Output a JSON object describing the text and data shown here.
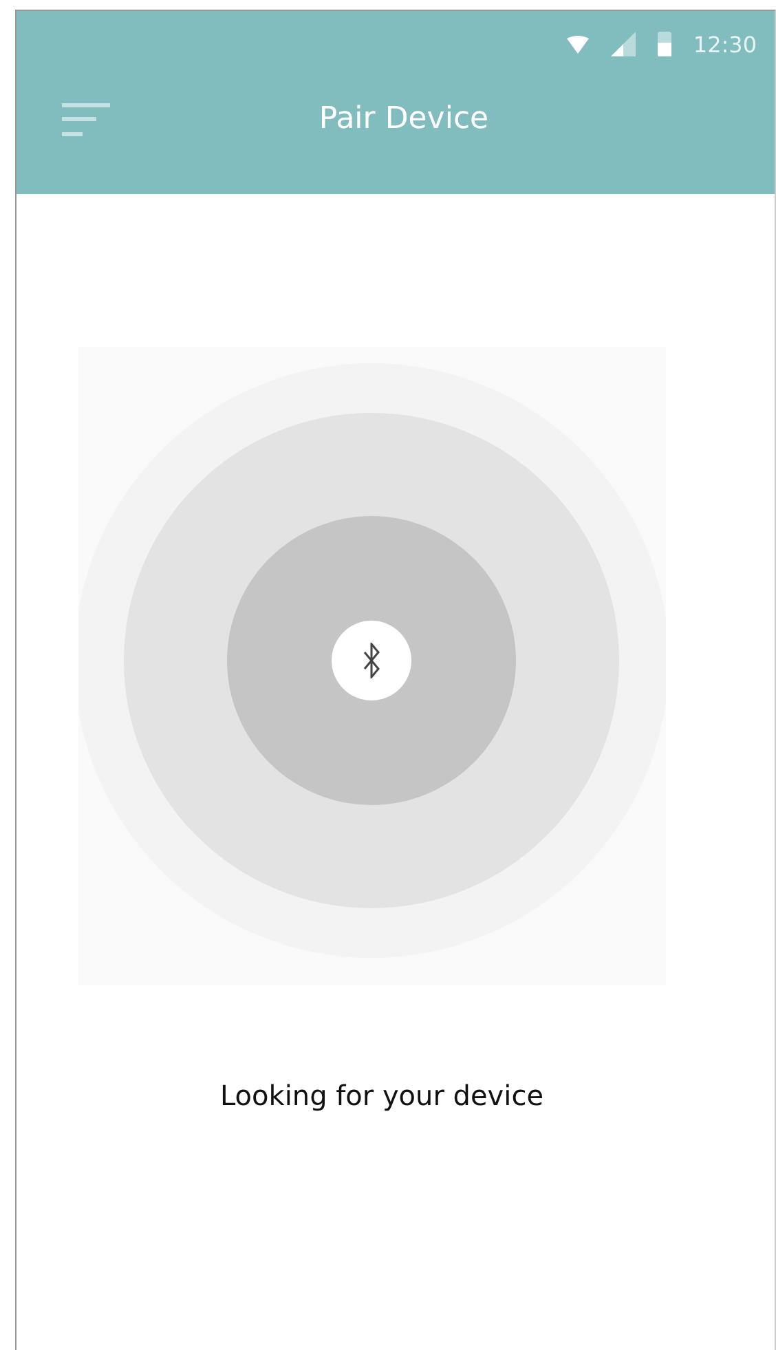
{
  "status_bar": {
    "time": "12:30"
  },
  "app_bar": {
    "title": "Pair Device"
  },
  "message": "Looking for your device"
}
